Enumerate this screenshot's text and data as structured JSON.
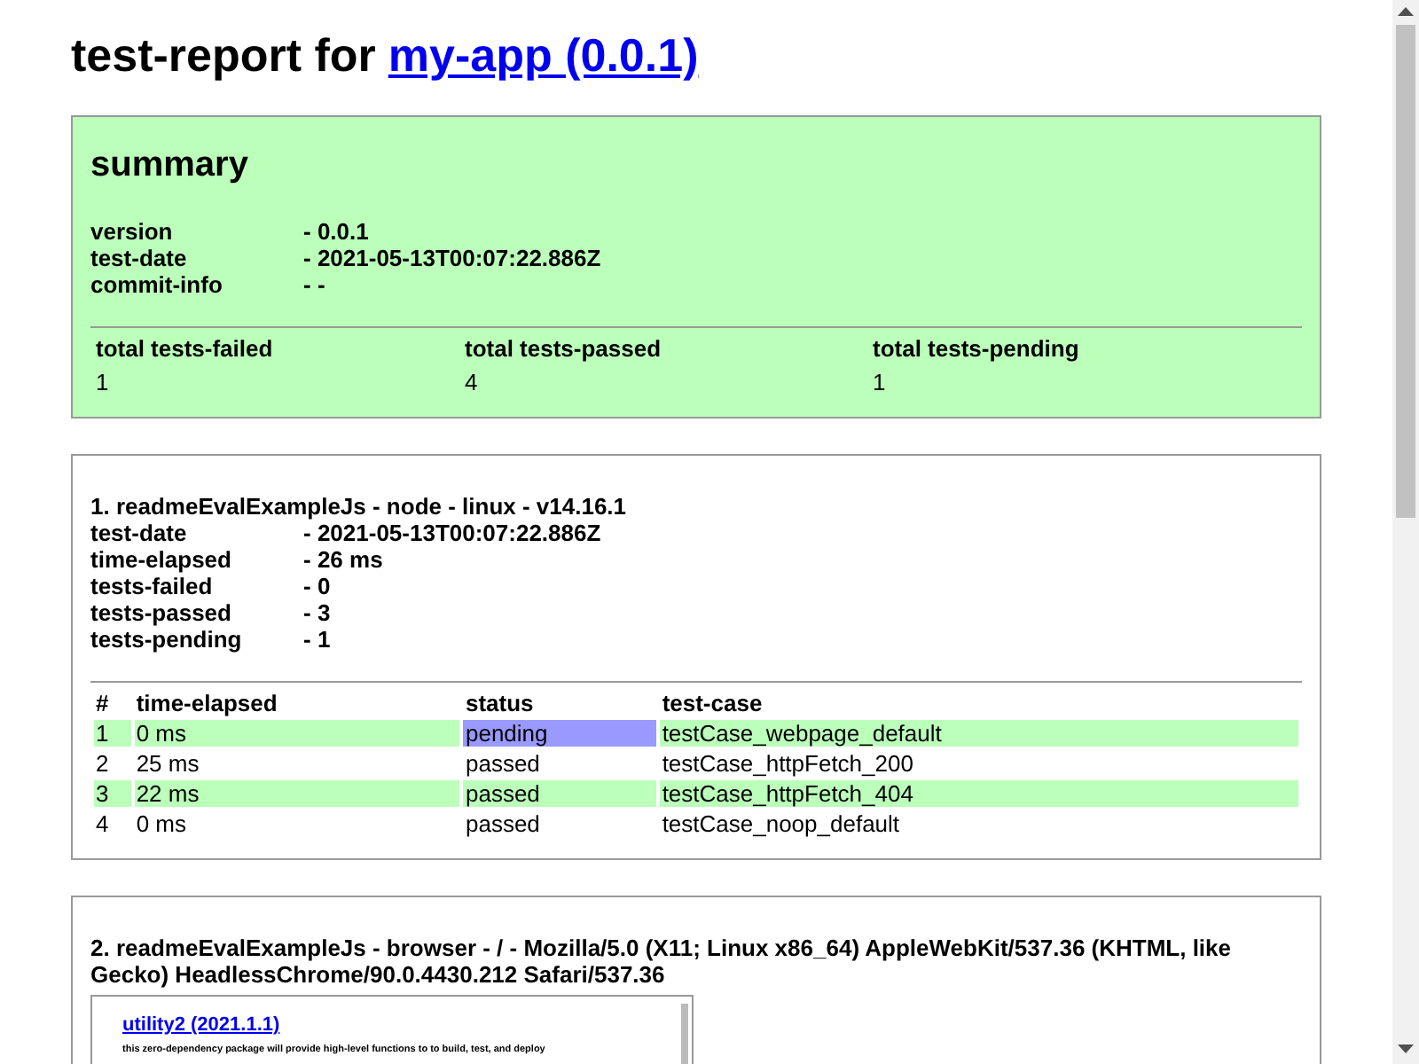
{
  "title": {
    "prefix": "test-report for",
    "link": "my-app (0.0.1)"
  },
  "summary": {
    "heading": "summary",
    "info": [
      {
        "label": "version",
        "value": "- 0.0.1"
      },
      {
        "label": "test-date",
        "value": "- 2021-05-13T00:07:22.886Z"
      },
      {
        "label": "commit-info",
        "value": "- -"
      }
    ],
    "totals": [
      {
        "label": "total tests-failed",
        "value": "1"
      },
      {
        "label": "total tests-passed",
        "value": "4"
      },
      {
        "label": "total tests-pending",
        "value": "1"
      }
    ]
  },
  "reports": [
    {
      "heading": "1. readmeEvalExampleJs - node - linux - v14.16.1",
      "info": [
        {
          "label": "test-date",
          "value": "- 2021-05-13T00:07:22.886Z"
        },
        {
          "label": "time-elapsed",
          "value": "- 26 ms"
        },
        {
          "label": "tests-failed",
          "value": "- 0"
        },
        {
          "label": "tests-passed",
          "value": "- 3"
        },
        {
          "label": "tests-pending",
          "value": "- 1"
        }
      ],
      "columns": [
        "#",
        "time-elapsed",
        "status",
        "test-case"
      ],
      "rows": [
        {
          "cells": [
            "1",
            "0 ms",
            "pending",
            "testCase_webpage_default"
          ],
          "highlighted": true,
          "status_highlighted": true
        },
        {
          "cells": [
            "2",
            "25 ms",
            "passed",
            "testCase_httpFetch_200"
          ],
          "highlighted": false,
          "status_highlighted": false
        },
        {
          "cells": [
            "3",
            "22 ms",
            "passed",
            "testCase_httpFetch_404"
          ],
          "highlighted": true,
          "status_highlighted": false
        },
        {
          "cells": [
            "4",
            "0 ms",
            "passed",
            "testCase_noop_default"
          ],
          "highlighted": false,
          "status_highlighted": false
        }
      ]
    },
    {
      "heading": "2. readmeEvalExampleJs - browser - / - Mozilla/5.0 (X11; Linux x86_64) AppleWebKit/537.36 (KHTML, like Gecko) HeadlessChrome/90.0.4430.212 Safari/537.36",
      "screenshot": {
        "link": "utility2 (2021.1.1)",
        "text": "this zero-dependency package will provide high-level functions to to build, test, and deploy"
      }
    }
  ]
}
